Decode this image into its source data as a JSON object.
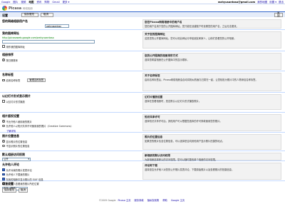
{
  "topbar": {
    "nav": [
      "Google",
      "图片",
      "视频",
      "地图",
      "资讯",
      "购物",
      "Gmail",
      "更多 ▾"
    ],
    "active_index": 3,
    "email": "wahyusantoso@gmail.com",
    "links": [
      "我的地图",
      "设置 ▾",
      "退出"
    ]
  },
  "logo": {
    "name": "Picasa",
    "sub": "网络相册"
  },
  "titlebar": {
    "title": "设置",
    "primary_button": "保存更改",
    "secondary_button": "取消",
    "right_button": "返回"
  },
  "sections": [
    {
      "title": "您的网络相册用户名",
      "value": "wahyusantoso",
      "help_title": "您在Picasa网络相册中的用户名",
      "help_text": "您的用户名用于您的公开图库网址。您只能在创建账户时设置您的用户名，之后无法更改。"
    },
    {
      "title": "我的图库网址",
      "url": "http://picasaweb.google.com/wahyusantoso",
      "option": "用作我的图库网址",
      "help_title": "关于您的图库网址",
      "help_text": "这是您的公开图库网址。您可以将此网址分享给朋友和家人，让他们查看您的公开相册。"
    },
    {
      "title": "相册排序",
      "select_label": "按日期排序",
      "help_title": "您的公开图库的相册排序方式",
      "help_text": "选择您希望相册在公开图库中的显示顺序。"
    },
    {
      "title": "名称标签",
      "checkbox_label": "启用名称标签",
      "button": "管理名称标签",
      "help_title": "关于名称标签",
      "help_text": "启用名称标签后，Picasa网络相册会自动将相似的面孔归类在一起，让您轻松为照片中的人物添加名称标签。"
    },
    {
      "title": "以幻灯片形式显示照片",
      "checkbox_label": "以幻灯片形式播放",
      "help_title": "幻灯片播放设置",
      "help_text": "选择在查看相册时，是否默认以幻灯片形式播放照片。"
    },
    {
      "title": "相片版权设置",
      "options": [
        "不允许他人使用我的照片",
        "允许他人以知识共享许可使用我的照片（Creative Commons）"
      ],
      "link": "了解详情",
      "help_title": "知识共享许可",
      "help_text": "选择知识共享许可后，其他用户可以根据您选择的许可条款使用您的照片。"
    },
    {
      "title": "照片位置信息",
      "options": [
        "显示照片的位置信息",
        "不显示照片的位置信息"
      ],
      "help_title": "照片的位置信息",
      "help_text": "如果您的照片包含位置信息，可以选择是否向其他用户显示照片拍摄的地点。"
    },
    {
      "title": "默认相册访问权限",
      "select_label": "公开",
      "help_title": "新相册的默认访问权限",
      "help_text": "为新相册选择默认的访问权限。您可以随时更改单个相册的访问权限。"
    },
    {
      "title": "允许他人评论",
      "options": [
        "允许对我的照片发表评论",
        "允许他人下载我的照片",
        "在我的相册中显示照片的 EXIF 信息",
        "允许他人查看我的照片所在位置"
      ],
      "help_title": "评论和下载",
      "help_text": "选择是否允许他人对您的公开照片发表评论、下载原始照片以及查看照片的拍摄信息。"
    },
    {
      "title": "语言设置",
      "select_label": "中文（简体）",
      "help_title": "",
      "help_text": ""
    }
  ],
  "bottom": {
    "save": "保存更改",
    "cancel": "取消"
  },
  "footer": {
    "copyright": "©2009 Google",
    "links": [
      "Picasa 主页",
      "服务条款",
      "隐私权政策",
      "帮助",
      "Google 主页"
    ]
  }
}
